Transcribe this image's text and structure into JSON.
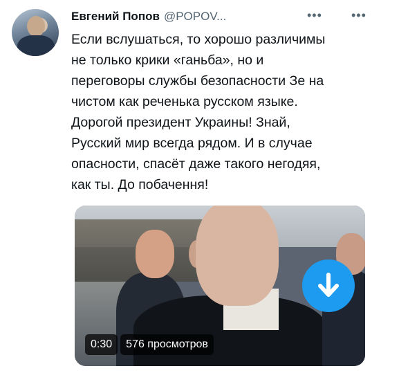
{
  "tweet": {
    "author": {
      "display_name": "Евгений Попов",
      "handle": "@POPOV...",
      "avatar_icon": "user-avatar"
    },
    "more_menu_icons": [
      "more-dots-icon",
      "more-dots-icon"
    ],
    "text_lines": [
      "Если вслушаться, то хорошо различимы",
      "не только крики «ганьба», но и",
      "переговоры службы безопасности Зе на",
      "чистом как реченька русском языке.",
      "Дорогой президент Украины! Знай,",
      "Русский мир всегда рядом. И в случае",
      "опасности, спасёт даже такого негодяя,",
      "как ты. До побачення!"
    ],
    "video": {
      "duration": "0:30",
      "views": "576 просмотров",
      "download_icon": "download-arrow-icon"
    }
  },
  "colors": {
    "accent": "#1d9bf0",
    "text": "#0f1419",
    "secondary_text": "#536471"
  }
}
